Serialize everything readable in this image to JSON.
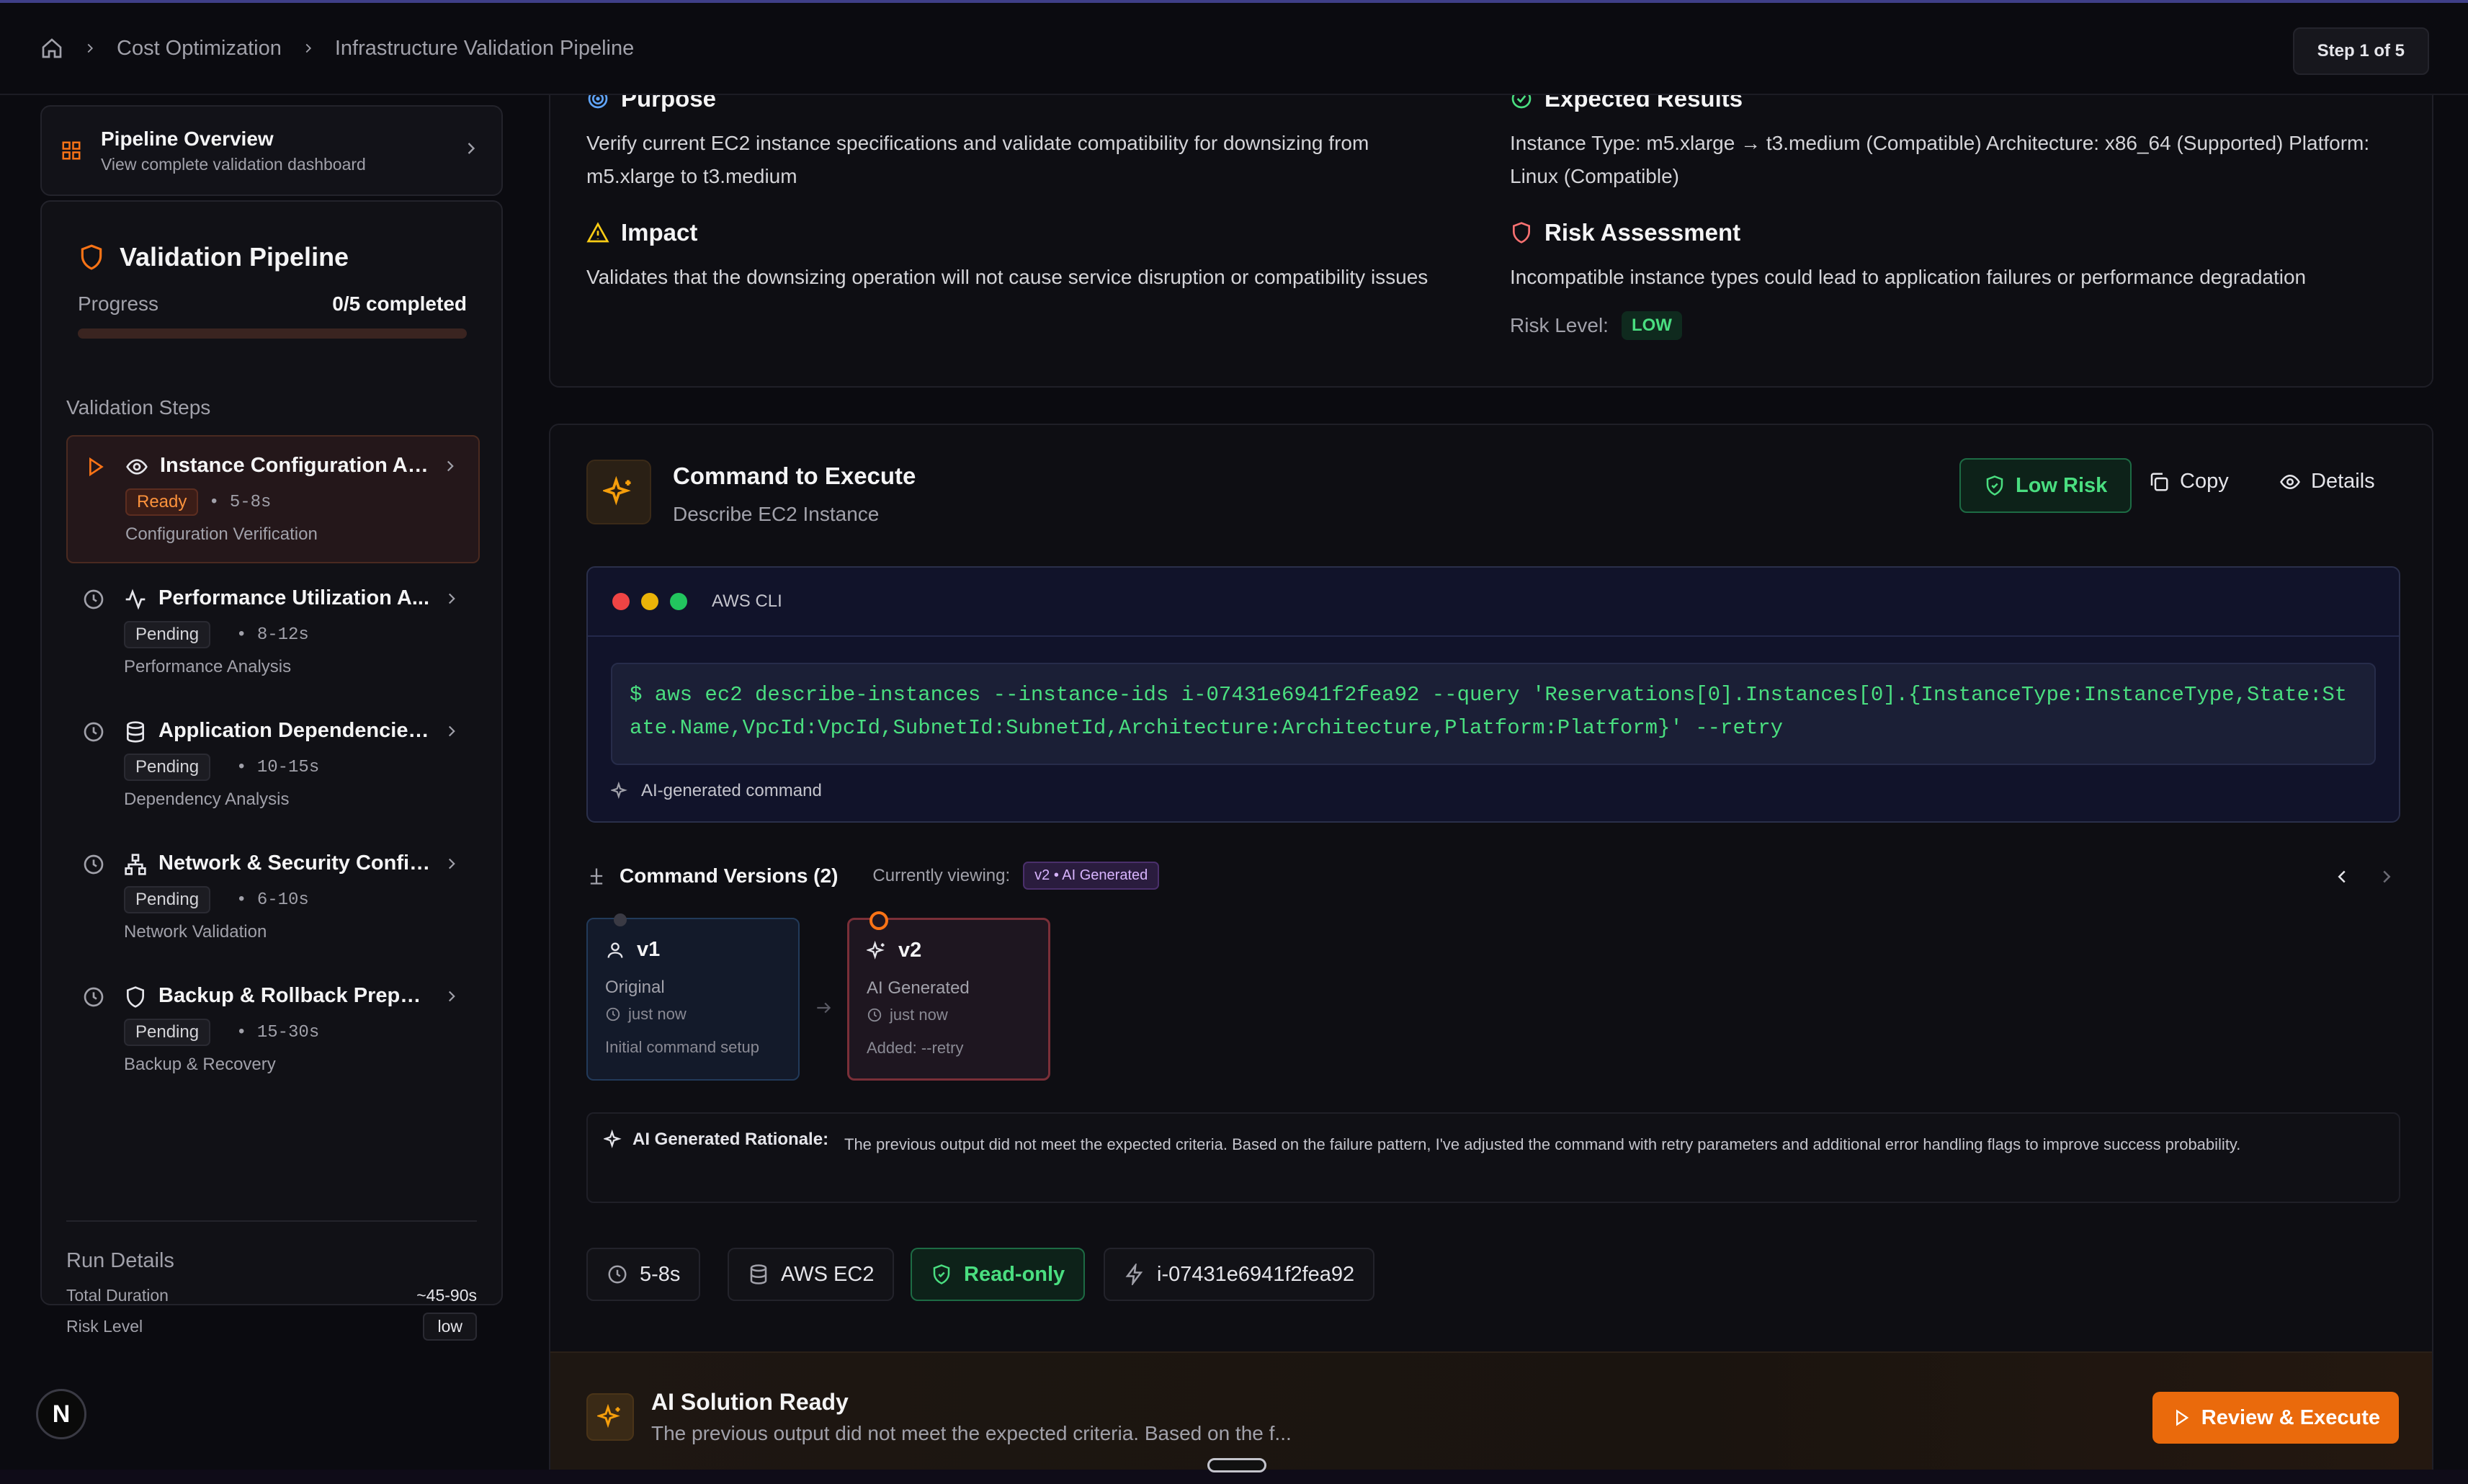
{
  "breadcrumb": {
    "items": [
      "Cost Optimization",
      "Infrastructure Validation Pipeline"
    ]
  },
  "step_indicator": "Step 1 of 5",
  "overview": {
    "title": "Pipeline Overview",
    "subtitle": "View complete validation dashboard"
  },
  "pipeline": {
    "title": "Validation Pipeline",
    "progress_label": "Progress",
    "progress_value": "0/5 completed",
    "progress_fraction": 0.0,
    "steps_heading": "Validation Steps",
    "steps": [
      {
        "name": "Instance Configuration An...",
        "status": "Ready",
        "duration": "5-8s",
        "category": "Configuration Verification",
        "icon": "eye-icon"
      },
      {
        "name": "Performance Utilization A...",
        "status": "Pending",
        "duration": "8-12s",
        "category": "Performance Analysis",
        "icon": "activity-icon"
      },
      {
        "name": "Application Dependencies ...",
        "status": "Pending",
        "duration": "10-15s",
        "category": "Dependency Analysis",
        "icon": "database-icon"
      },
      {
        "name": "Network & Security Config...",
        "status": "Pending",
        "duration": "6-10s",
        "category": "Network Validation",
        "icon": "network-icon"
      },
      {
        "name": "Backup & Rollback Prepar...",
        "status": "Pending",
        "duration": "15-30s",
        "category": "Backup & Recovery",
        "icon": "shield-icon"
      }
    ],
    "run_details": {
      "heading": "Run Details",
      "duration_label": "Total Duration",
      "duration_value": "~45-90s",
      "risk_label": "Risk Level",
      "risk_value": "low"
    }
  },
  "avatar_letter": "N",
  "info": {
    "purpose": {
      "title": "Purpose",
      "text": "Verify current EC2 instance specifications and validate compatibility for downsizing from m5.xlarge to t3.medium"
    },
    "expected": {
      "title": "Expected Results",
      "text": "Instance Type: m5.xlarge → t3.medium (Compatible) Architecture: x86_64 (Supported) Platform: Linux (Compatible)"
    },
    "impact": {
      "title": "Impact",
      "text": "Validates that the downsizing operation will not cause service disruption or compatibility issues"
    },
    "risk": {
      "title": "Risk Assessment",
      "text": "Incompatible instance types could lead to application failures or performance degradation",
      "level_label": "Risk Level:",
      "level_value": "LOW"
    }
  },
  "command": {
    "title": "Command to Execute",
    "subtitle": "Describe EC2 Instance",
    "risk_button": "Low Risk",
    "copy_button": "Copy",
    "details_button": "Details",
    "terminal_label": "AWS CLI",
    "code": "$ aws ec2 describe-instances --instance-ids i-07431e6941f2fea92 --query 'Reservations[0].Instances[0].{InstanceType:InstanceType,State:State.Name,VpcId:VpcId,SubnetId:SubnetId,Architecture:Architecture,Platform:Platform}' --retry",
    "ai_note": "AI-generated command"
  },
  "versions": {
    "title": "Command Versions (2)",
    "viewing_label": "Currently viewing:",
    "viewing_value": "v2 • AI Generated",
    "items": [
      {
        "id": "v1",
        "type": "Original",
        "time": "just now",
        "note": "Initial command setup"
      },
      {
        "id": "v2",
        "type": "AI Generated",
        "time": "just now",
        "note": "Added: --retry"
      }
    ]
  },
  "rationale": {
    "label": "AI Generated Rationale:",
    "text": "The previous output did not meet the expected criteria. Based on the failure pattern, I've adjusted the command with retry parameters and additional error handling flags to improve success probability."
  },
  "chips": {
    "duration": "5-8s",
    "service": "AWS EC2",
    "mode": "Read-only",
    "instance": "i-07431e6941f2fea92"
  },
  "solution": {
    "title": "AI Solution Ready",
    "text": "The previous output did not meet the expected criteria. Based on the f...",
    "button": "Review & Execute"
  },
  "colors": {
    "accent": "#f97316",
    "success": "#4ade80",
    "background": "#0b0b10"
  }
}
